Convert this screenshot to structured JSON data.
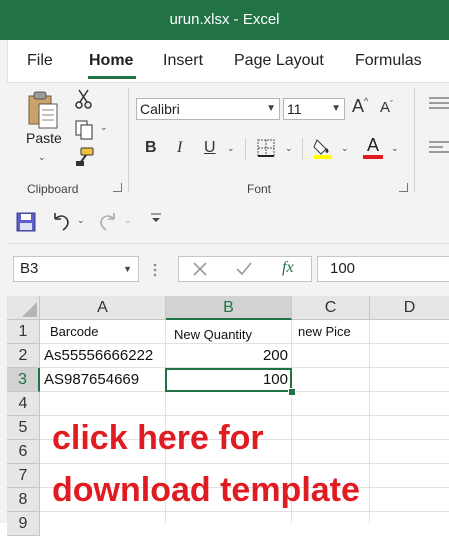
{
  "window": {
    "title": "urun.xlsx  -  Excel"
  },
  "menu": {
    "tabs": [
      "File",
      "Home",
      "Insert",
      "Page Layout",
      "Formulas"
    ]
  },
  "ribbon": {
    "clipboard": {
      "paste_label": "Paste",
      "group_label": "Clipboard"
    },
    "font": {
      "family": "Calibri",
      "size": "11",
      "group_label": "Font",
      "bold": "B",
      "italic": "I",
      "underline": "U",
      "grow": "A",
      "shrink": "A",
      "color_letter": "A"
    }
  },
  "formula_bar": {
    "name_box": "B3",
    "fx": "fx",
    "formula": "100"
  },
  "sheet": {
    "columns": [
      "A",
      "B",
      "C",
      "D"
    ],
    "rows": [
      "1",
      "2",
      "3",
      "4",
      "5",
      "6",
      "7",
      "8",
      "9"
    ],
    "cells": {
      "A1": "Barcode",
      "B1": "New Quantity",
      "C1": "new Pice",
      "A2": "As55556666222",
      "B2": "200",
      "A3": "AS987654669",
      "B3": "100"
    },
    "selected_cell": "B3"
  },
  "overlay": {
    "line1": "click here for",
    "line2": "download template"
  },
  "colors": {
    "accent": "#217346",
    "overlay_text": "#e11b22"
  }
}
